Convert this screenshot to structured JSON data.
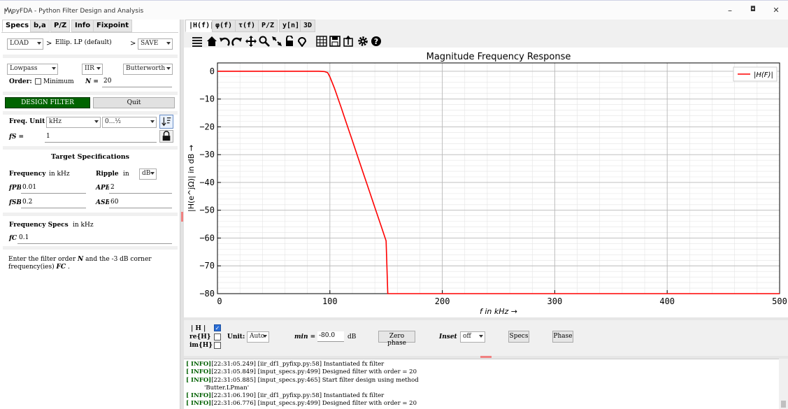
{
  "window": {
    "title": "pyFDA - Python Filter Design and Analysis",
    "minimize": "–",
    "maximize": "◘",
    "close": "✕"
  },
  "left_tabs": [
    "Specs",
    "b,a",
    "P/Z",
    "Info",
    "Fixpoint"
  ],
  "load": {
    "load_label": "LOAD",
    "arrow": ">",
    "filter": "Ellip. LP (default)",
    "arrow2": ">",
    "save_label": "SAVE"
  },
  "filter_type": {
    "response": "Lowpass",
    "kind": "IIR",
    "method": "Butterworth"
  },
  "order": {
    "label": "Order:",
    "minimum_label": "Minimum",
    "n_label": "N =",
    "n_value": "20"
  },
  "buttons": {
    "design": "DESIGN FILTER",
    "quit": "Quit"
  },
  "freq": {
    "unit_label": "Freq. Unit",
    "unit": "kHz",
    "range": "0...½",
    "fs_label": "fS =",
    "fs_value": "1"
  },
  "target": {
    "title": "Target Specifications",
    "freq_label": "Frequency",
    "freq_unit": "in kHz",
    "ripple_label": "Ripple",
    "ripple_in": "in",
    "ripple_unit": "dB",
    "fPB_label": "fPB",
    "fPB": "0.01",
    "APB_label": "APB",
    "APB": "2",
    "fSB_label": "fSB",
    "fSB": "0.2",
    "ASB_label": "ASB",
    "ASB": "60"
  },
  "freqspecs": {
    "title": "Frequency Specs",
    "unit": "in kHz",
    "fc_label": "fC",
    "fc_value": "0.1"
  },
  "info_text": {
    "a": "Enter the filter order",
    "n": "N",
    "b": "and the -3 dB corner",
    "c": "frequency(ies)",
    "fc": "FC",
    "d": "."
  },
  "right_tabs": [
    "|H(f)|",
    "φ(f)",
    "τ(f)",
    "P/Z",
    "y[n]",
    "3D"
  ],
  "toolbar_icons": [
    "menu-icon",
    "home-icon",
    "undo-icon",
    "redo-icon",
    "pan-icon",
    "zoom-icon",
    "fit-icon",
    "lock-icon",
    "marker-icon",
    "grid-icon",
    "save-icon",
    "export-icon",
    "settings-icon",
    "help-icon"
  ],
  "chart_data": {
    "type": "line",
    "title": "Magnitude Frequency Response",
    "xlabel": "f in kHz →",
    "ylabel": "|H(e^jΩ)| in dB →",
    "xlim": [
      0,
      500
    ],
    "ylim": [
      -80,
      3
    ],
    "xticks": [
      "0",
      "100",
      "200",
      "300",
      "400",
      "500"
    ],
    "yticks": [
      "0",
      "−10",
      "−20",
      "−30",
      "−40",
      "−50",
      "−60",
      "−70",
      "−80"
    ],
    "grid": true,
    "legend_position": "top-right",
    "series": [
      {
        "name": "|H(F)|",
        "color": "#ff0000",
        "x": [
          0,
          60,
          90,
          95,
          98,
          100,
          102,
          104,
          106,
          108,
          110,
          112,
          115,
          120,
          125,
          130,
          135,
          140,
          145,
          150,
          151.5
        ],
        "y": [
          0,
          0,
          0,
          -0.1,
          -0.5,
          -2,
          -4,
          -6,
          -8.3,
          -10.7,
          -13,
          -15.4,
          -19,
          -25,
          -31,
          -37,
          -43,
          -49,
          -55,
          -61,
          -80
        ]
      }
    ]
  },
  "controls": {
    "h_label": "| H |",
    "re_label": "re{H}",
    "im_label": "im{H}",
    "unit_label": "Unit:",
    "unit": "Auto",
    "min_label": "min =",
    "min_value": "-80.0",
    "db_label": "dB",
    "zero_phase": "Zero phase",
    "inset_label": "Inset",
    "inset": "off",
    "specs": "Specs",
    "phase": "Phase"
  },
  "log": [
    {
      "tag": "[ INFO]",
      "text": "[22:31:05.249] [iir_df1_pyfixp.py:58] Instantiated fx filter"
    },
    {
      "tag": "[ INFO]",
      "text": "[22:31:05.849] [input_specs.py:499] Designed filter with order = 20"
    },
    {
      "tag": "[ INFO]",
      "text": "[22:31:05.885] [input_specs.py:465] Start filter design using method"
    },
    {
      "tag": "",
      "text": "'Butter.LPman'"
    },
    {
      "tag": "[ INFO]",
      "text": "[22:31:06.190] [iir_df1_pyfixp.py:58] Instantiated fx filter"
    },
    {
      "tag": "[ INFO]",
      "text": "[22:31:06.776] [input_specs.py:499] Designed filter with order = 20"
    }
  ]
}
